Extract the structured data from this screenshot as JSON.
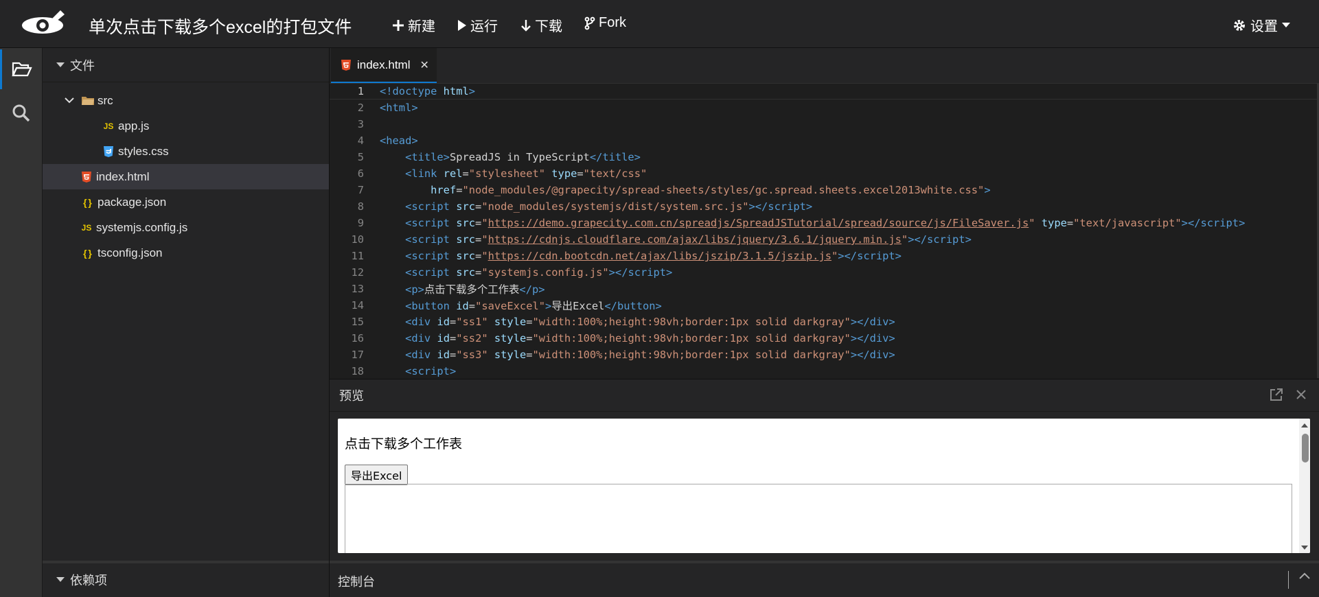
{
  "header": {
    "title": "单次点击下载多个excel的打包文件",
    "buttons": {
      "new": "新建",
      "run": "运行",
      "download": "下载",
      "fork": "Fork"
    },
    "settings": "设置"
  },
  "activity": {
    "items": [
      "folder-icon",
      "search-icon"
    ]
  },
  "sidebar": {
    "title": "文件",
    "tree": {
      "folder": "src",
      "children": [
        "app.js",
        "styles.css"
      ],
      "files": [
        {
          "name": "index.html",
          "icon": "html5-icon"
        },
        {
          "name": "package.json",
          "icon": "json-icon"
        },
        {
          "name": "systemjs.config.js",
          "icon": "js-icon"
        },
        {
          "name": "tsconfig.json",
          "icon": "json-icon"
        }
      ]
    },
    "deps_title": "依赖项"
  },
  "editor": {
    "tab": "index.html",
    "line_numbers": [
      "1",
      "2",
      "3",
      "4",
      "5",
      "6",
      "7",
      "8",
      "9",
      "10",
      "11",
      "12",
      "13",
      "14",
      "15",
      "16",
      "17",
      "18"
    ],
    "code": {
      "l1_doctype": "<!doctype",
      "l1_html": " html",
      "l2": "<html>",
      "l4": "<head>",
      "l5_text": "SpreadJS in TypeScript",
      "l6_rel": "\"stylesheet\"",
      "l6_type": "\"text/css\"",
      "l7_href": "\"node_modules/@grapecity/spread-sheets/styles/gc.spread.sheets.excel2013white.css\"",
      "l8_src": "\"node_modules/systemjs/dist/system.src.js\"",
      "l9_src": "https://demo.grapecity.com.cn/spreadjs/SpreadJSTutorial/spread/source/js/FileSaver.js",
      "l9_type": "\"text/javascript\"",
      "l10_src": "https://cdnjs.cloudflare.com/ajax/libs/jquery/3.6.1/jquery.min.js",
      "l11_src": "https://cdn.bootcdn.net/ajax/libs/jszip/3.1.5/jszip.js",
      "l12_src": "\"systemjs.config.js\"",
      "l13_text": "点击下载多个工作表",
      "l14_id": "\"saveExcel\"",
      "l14_text": "导出Excel",
      "l15_id": "\"ss1\"",
      "l16_id": "\"ss2\"",
      "l17_id": "\"ss3\"",
      "div_style": "\"width:100%;height:98vh;border:1px solid darkgray\""
    }
  },
  "preview": {
    "title": "预览",
    "heading": "点击下载多个工作表",
    "button": "导出Excel"
  },
  "console": {
    "title": "控制台"
  }
}
